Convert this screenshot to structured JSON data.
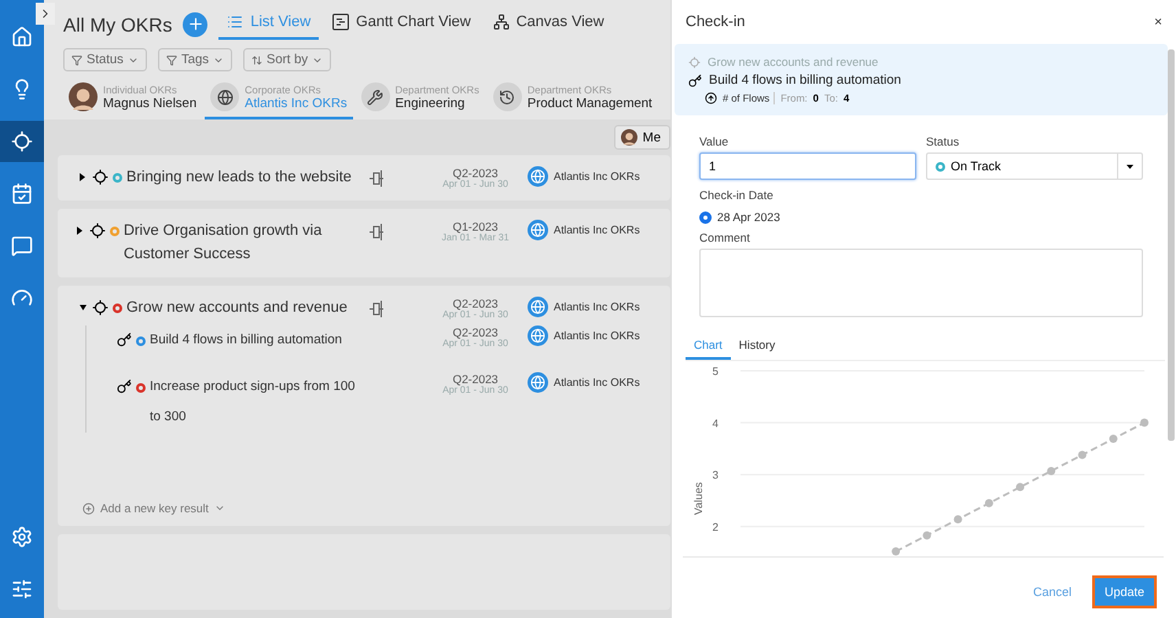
{
  "sidebar": {
    "items": [
      {
        "kind": "home",
        "selected": false
      },
      {
        "kind": "bulb",
        "selected": false
      },
      {
        "kind": "target",
        "selected": true
      },
      {
        "kind": "calendar",
        "selected": false
      },
      {
        "kind": "chat",
        "selected": false
      },
      {
        "kind": "gauge",
        "selected": false
      }
    ],
    "bottom_items": [
      {
        "kind": "settings"
      },
      {
        "kind": "sliders"
      }
    ]
  },
  "header": {
    "title": "All My OKRs",
    "views": [
      {
        "label": "List View",
        "kind": "list",
        "selected": true
      },
      {
        "label": "Gantt Chart View",
        "kind": "gantt",
        "selected": false
      },
      {
        "label": "Canvas View",
        "kind": "canvas",
        "selected": false
      }
    ]
  },
  "filters": [
    {
      "label": "Status",
      "kind": "filter"
    },
    {
      "label": "Tags",
      "kind": "filter"
    },
    {
      "label": "Sort by",
      "kind": "sort"
    }
  ],
  "scopes": [
    {
      "caption": "Individual OKRs",
      "name": "Magnus Nielsen",
      "kind": "person",
      "selected": false
    },
    {
      "caption": "Corporate OKRs",
      "name": "Atlantis Inc OKRs",
      "kind": "globe",
      "selected": true
    },
    {
      "caption": "Department OKRs",
      "name": "Engineering",
      "kind": "wrench",
      "selected": false
    },
    {
      "caption": "Department OKRs",
      "name": "Product Management",
      "kind": "history",
      "selected": false
    }
  ],
  "me_button": "Me",
  "objectives": [
    {
      "title": "Bringing new leads to the website",
      "color": "#3bb5c8",
      "expanded": false,
      "quarter": "Q2-2023",
      "dates": "Apr 01 - Jun 30",
      "owner": "Atlantis Inc OKRs"
    },
    {
      "title": "Drive Organisation growth via Customer Success",
      "color": "#f0a030",
      "expanded": false,
      "quarter": "Q1-2023",
      "dates": "Jan 01 - Mar 31",
      "owner": "Atlantis Inc OKRs"
    },
    {
      "title": "Grow new accounts and revenue",
      "color": "#d9342b",
      "expanded": true,
      "quarter": "Q2-2023",
      "dates": "Apr 01 - Jun 30",
      "owner": "Atlantis Inc OKRs",
      "add_key_result": "Add a new key result",
      "key_results": [
        {
          "title": "Build 4 flows in billing automation",
          "color": "#2d8fe0",
          "quarter": "Q2-2023",
          "dates": "Apr 01 - Jun 30",
          "owner": "Atlantis Inc OKRs"
        },
        {
          "title": "Increase product sign-ups from 100 to 300",
          "color": "#d9342b",
          "quarter": "Q2-2023",
          "dates": "Apr 01 - Jun 30",
          "owner": "Atlantis Inc OKRs"
        }
      ]
    }
  ],
  "checkin": {
    "title": "Check-in",
    "close": "×",
    "objective": "Grow new accounts and revenue",
    "key_result": "Build 4 flows in billing automation",
    "metric": "# of Flows",
    "from_label": "From:",
    "from": "0",
    "to_label": "To:",
    "to": "4",
    "value_label": "Value",
    "value": "1",
    "status_label": "Status",
    "status": "On Track",
    "date_label": "Check-in Date",
    "date": "28 Apr 2023",
    "date_selected": true,
    "comment_label": "Comment",
    "tabs": [
      {
        "label": "Chart",
        "selected": true
      },
      {
        "label": "History",
        "selected": false
      }
    ],
    "chart_data": {
      "type": "line",
      "ylabel": "Values",
      "yticks": [
        2,
        3,
        4,
        5
      ],
      "ylim": [
        1.4,
        5
      ],
      "grid": true,
      "series": [
        {
          "color": "#bdbdbd",
          "line_style": "dashed",
          "marker": "circle",
          "values": [
            null,
            null,
            null,
            null,
            null,
            1.52,
            1.83,
            2.14,
            2.45,
            2.76,
            3.07,
            3.38,
            3.69,
            4
          ]
        }
      ]
    },
    "buttons": [
      {
        "label": "Cancel",
        "kind": "secondary"
      },
      {
        "label": "Update",
        "kind": "primary"
      }
    ]
  }
}
